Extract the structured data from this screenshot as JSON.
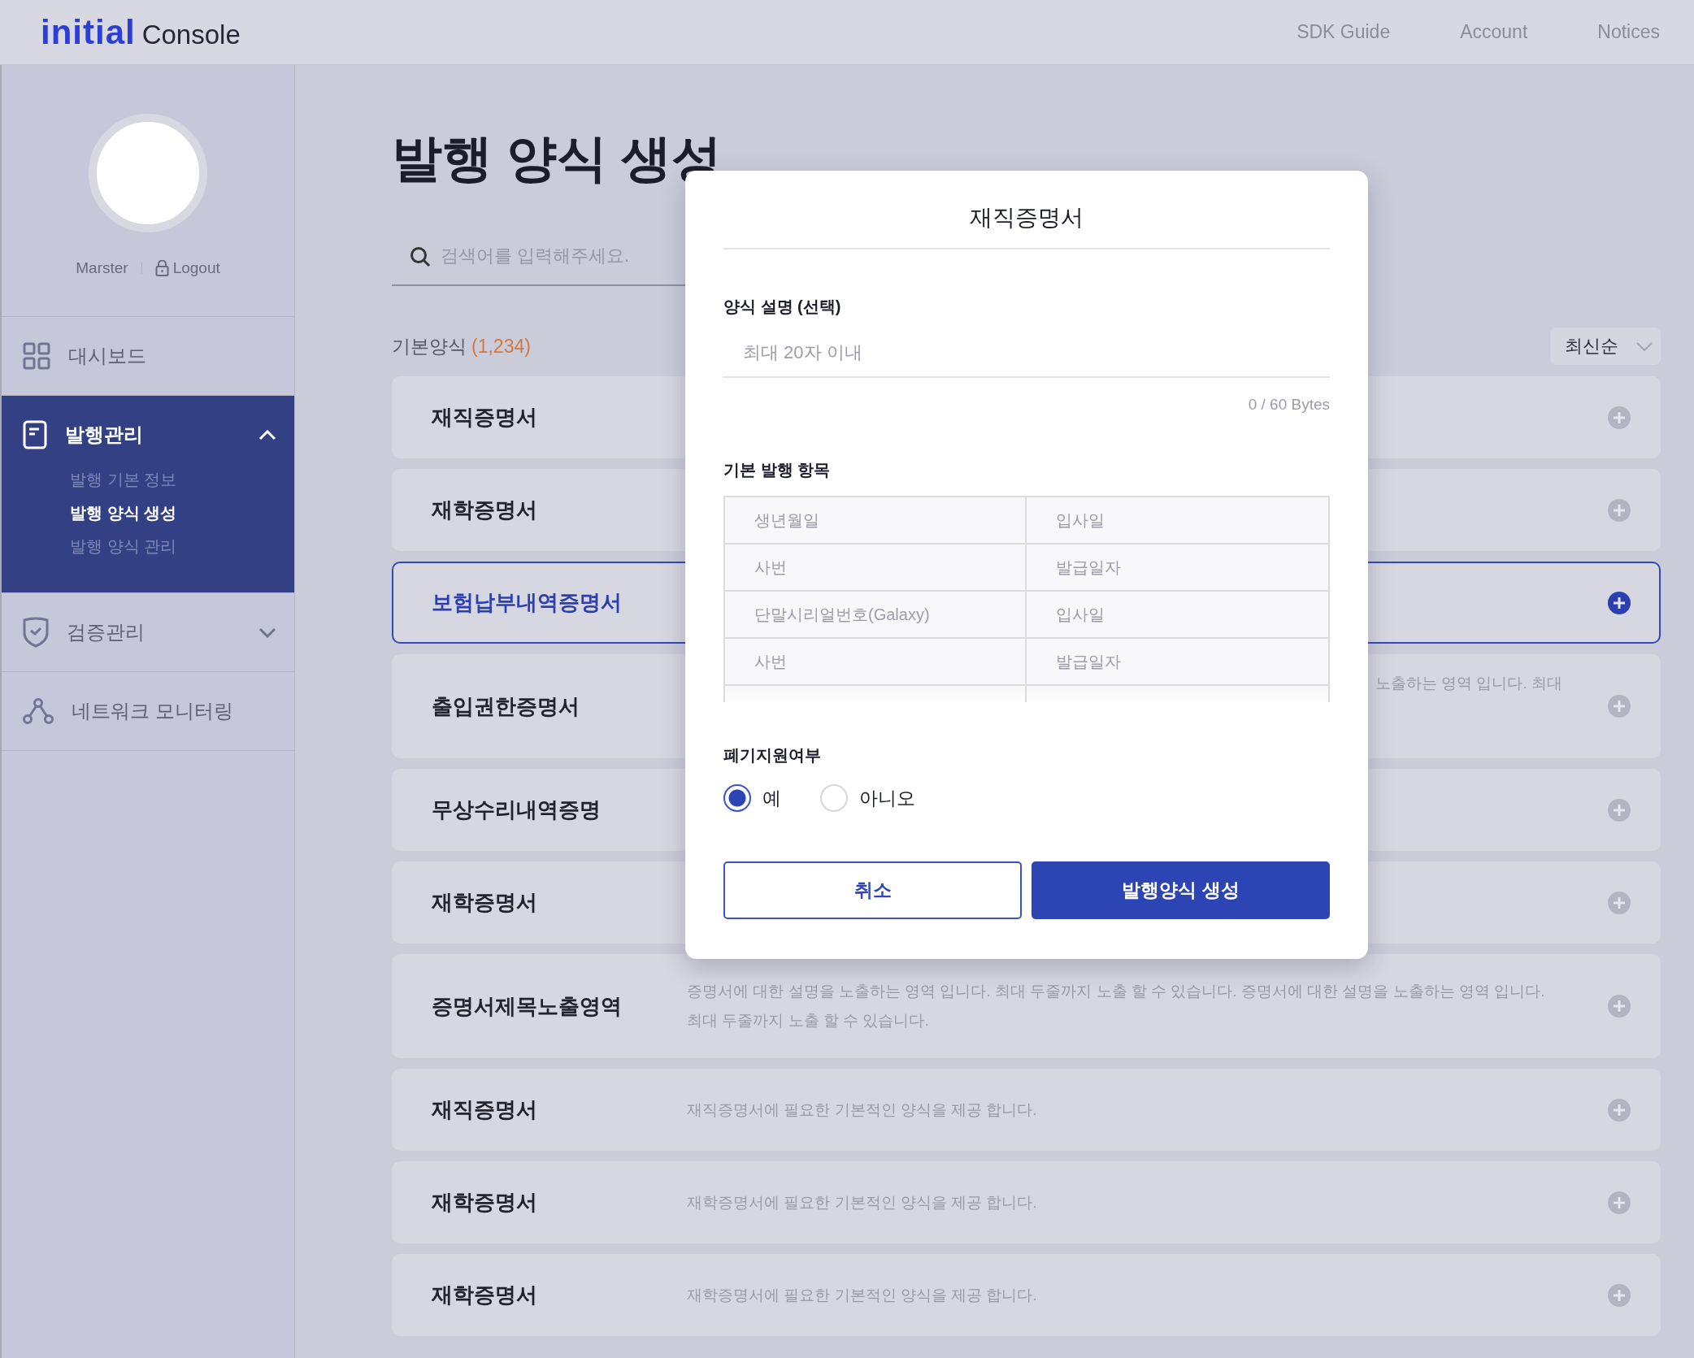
{
  "header": {
    "logo_brand": "initial",
    "logo_product": "Console",
    "nav": [
      "SDK Guide",
      "Account",
      "Notices"
    ]
  },
  "sidebar": {
    "user": "Marster",
    "logout": "Logout",
    "items": [
      {
        "label": "대시보드",
        "selected": false
      },
      {
        "label": "발행관리",
        "selected": true,
        "expanded": true,
        "children": [
          {
            "label": "발행 기본 정보",
            "selected": false
          },
          {
            "label": "발행 양식 생성",
            "selected": true
          },
          {
            "label": "발행 양식 관리",
            "selected": false
          }
        ]
      },
      {
        "label": "검증관리",
        "selected": false,
        "expanded": false
      },
      {
        "label": "네트워크 모니터링",
        "selected": false
      }
    ]
  },
  "main": {
    "title": "발행 양식 생성",
    "search": {
      "placeholder": "검색어를 입력해주세요."
    },
    "section_label": "기본양식",
    "count": "(1,234)",
    "sort": "최신순",
    "rows": [
      {
        "title": "재직증명서",
        "selected": false
      },
      {
        "title": "재학증명서",
        "selected": false
      },
      {
        "title": "보험납부내역증명서",
        "selected": true
      },
      {
        "title": "출입권한증명서",
        "selected": false,
        "description": "노출하는 영역 입니다. 최대",
        "clipped": true
      },
      {
        "title": "무상수리내역증명",
        "selected": false
      },
      {
        "title": "재학증명서",
        "selected": false
      },
      {
        "title": "증명서제목노출영역",
        "selected": false,
        "description": "증명서에 대한 설명을 노출하는 영역 입니다. 최대 두줄까지 노출 할 수 있습니다. 증명서에 대한 설명을 노출하는 영역 입니다. 최대 두줄까지 노출 할 수 있습니다.",
        "clipped": false
      },
      {
        "title": "재직증명서",
        "selected": false,
        "description": "재직증명서에 필요한 기본적인 양식을 제공 합니다.",
        "clipped": false
      },
      {
        "title": "재학증명서",
        "selected": false,
        "description": "재학증명서에 필요한 기본적인 양식을 제공 합니다.",
        "clipped": false
      },
      {
        "title": "재학증명서",
        "selected": false,
        "description": "재학증명서에 필요한 기본적인 양식을 제공 합니다.",
        "clipped": false
      }
    ]
  },
  "modal": {
    "title": "재직증명서",
    "description_label": "양식 설명 (선택)",
    "description_placeholder": "최대 20자 이내",
    "byte_counter": "0 / 60 Bytes",
    "items_label": "기본 발행 항목",
    "items": [
      [
        "생년월일",
        "입사일"
      ],
      [
        "사번",
        "발급일자"
      ],
      [
        "단말시리얼번호(Galaxy)",
        "입사일"
      ],
      [
        "사번",
        "발급일자"
      ]
    ],
    "disposal_label": "폐기지원여부",
    "options": [
      {
        "label": "예",
        "selected": true
      },
      {
        "label": "아니오",
        "selected": false
      }
    ],
    "cancel": "취소",
    "submit": "발행양식 생성"
  }
}
